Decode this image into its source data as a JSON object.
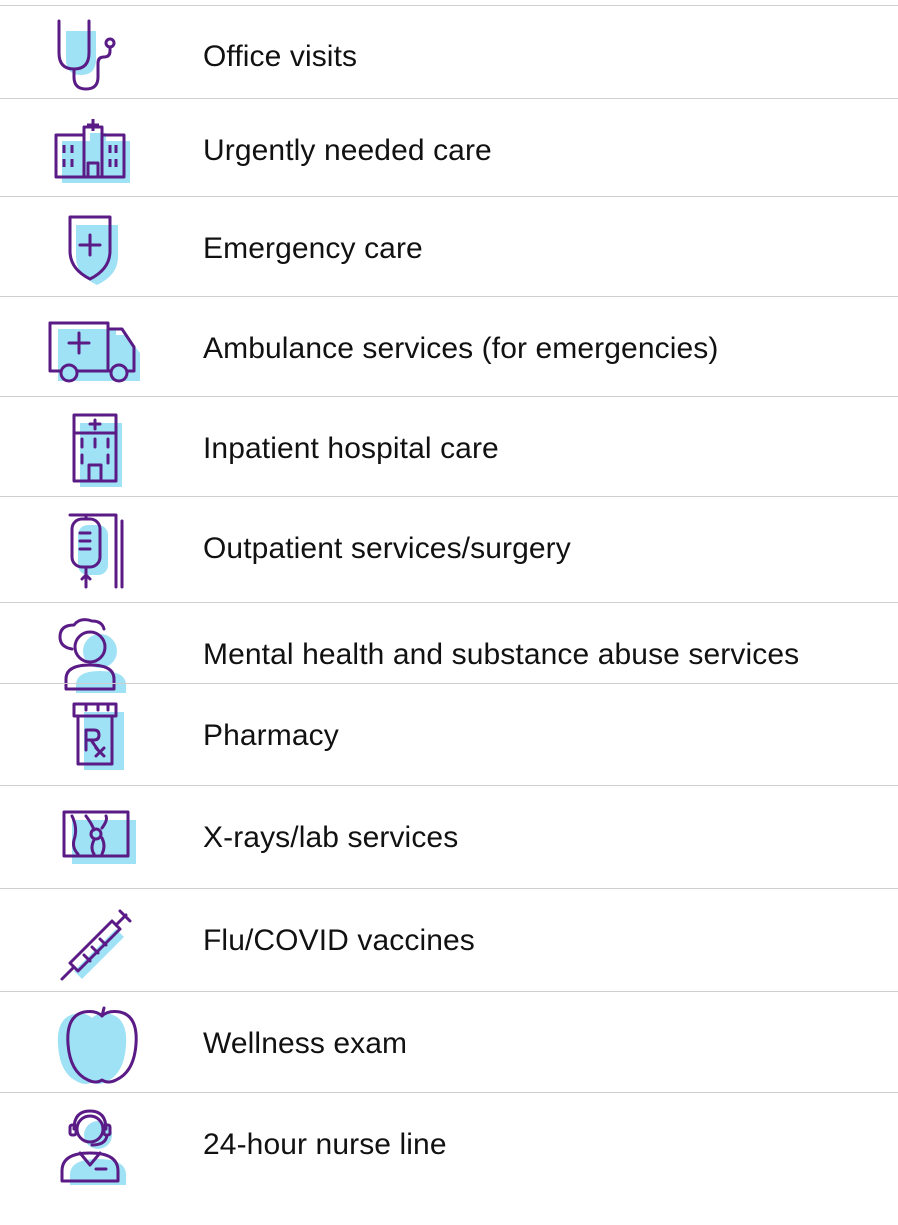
{
  "theme": {
    "stroke": "#5a1b86",
    "fill": "#9fe2f5",
    "divider": "#cfcfcf",
    "text": "#111111"
  },
  "services": [
    {
      "label": "Office visits",
      "icon": "stethoscope-icon"
    },
    {
      "label": "Urgently needed care",
      "icon": "clinic-building-icon"
    },
    {
      "label": "Emergency care",
      "icon": "shield-plus-icon"
    },
    {
      "label": "Ambulance services (for emergencies)",
      "icon": "ambulance-icon"
    },
    {
      "label": "Inpatient hospital care",
      "icon": "hospital-icon"
    },
    {
      "label": "Outpatient services/surgery",
      "icon": "iv-bag-icon"
    },
    {
      "label": "Mental health and substance abuse services",
      "icon": "mental-health-person-icon"
    },
    {
      "label": "Pharmacy",
      "icon": "rx-bottle-icon"
    },
    {
      "label": "X-rays/lab services",
      "icon": "xray-icon"
    },
    {
      "label": "Flu/COVID vaccines",
      "icon": "syringe-icon"
    },
    {
      "label": "Wellness exam",
      "icon": "apple-icon"
    },
    {
      "label": "24-hour nurse line",
      "icon": "nurse-headset-icon"
    }
  ]
}
